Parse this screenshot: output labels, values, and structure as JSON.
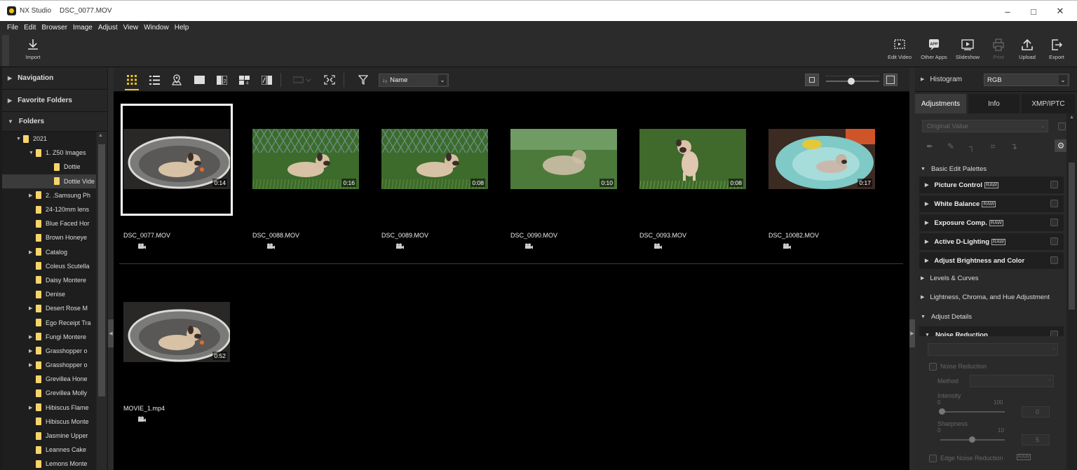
{
  "titlebar": {
    "app": "NX Studio",
    "file": "DSC_0077.MOV"
  },
  "menu": [
    "File",
    "Edit",
    "Browser",
    "Image",
    "Adjust",
    "View",
    "Window",
    "Help"
  ],
  "toolbar": {
    "import": "Import",
    "right": [
      {
        "label": "Edit Video",
        "icon": "edit-video-icon",
        "enabled": true
      },
      {
        "label": "Other Apps",
        "icon": "other-apps-icon",
        "enabled": true
      },
      {
        "label": "Slideshow",
        "icon": "slideshow-icon",
        "enabled": true
      },
      {
        "label": "Print",
        "icon": "print-icon",
        "enabled": false
      },
      {
        "label": "Upload",
        "icon": "upload-icon",
        "enabled": true
      },
      {
        "label": "Export",
        "icon": "export-icon",
        "enabled": true
      }
    ]
  },
  "left_panel": {
    "navigation": "Navigation",
    "favorites": "Favorite Folders",
    "folders": "Folders",
    "tree": [
      {
        "label": "2021",
        "level": 1,
        "state": "open"
      },
      {
        "label": "1. Z50 Images",
        "level": 2,
        "state": "open"
      },
      {
        "label": "Dottie",
        "level": 3,
        "state": "none"
      },
      {
        "label": "Dottie Vide",
        "level": 3,
        "state": "none",
        "selected": true
      },
      {
        "label": "2. .Samsung Ph",
        "level": 2,
        "state": "closed"
      },
      {
        "label": "24-120mm lens",
        "level": 2,
        "state": "none"
      },
      {
        "label": "Blue Faced Hor",
        "level": 2,
        "state": "none"
      },
      {
        "label": "Brown Honeye",
        "level": 2,
        "state": "none"
      },
      {
        "label": "Catalog",
        "level": 2,
        "state": "closed"
      },
      {
        "label": "Coleus Scutella",
        "level": 2,
        "state": "none"
      },
      {
        "label": "Daisy Montere",
        "level": 2,
        "state": "none"
      },
      {
        "label": "Denise",
        "level": 2,
        "state": "none"
      },
      {
        "label": "Desert Rose M",
        "level": 2,
        "state": "closed"
      },
      {
        "label": "Ego Receipt Tra",
        "level": 2,
        "state": "none"
      },
      {
        "label": "Fungi Montere",
        "level": 2,
        "state": "closed"
      },
      {
        "label": "Grasshopper o",
        "level": 2,
        "state": "closed"
      },
      {
        "label": "Grasshopper o",
        "level": 2,
        "state": "closed"
      },
      {
        "label": "Grevillea Hone",
        "level": 2,
        "state": "none"
      },
      {
        "label": "Grevillea Molly",
        "level": 2,
        "state": "none"
      },
      {
        "label": "Hibiscus Flame",
        "level": 2,
        "state": "closed"
      },
      {
        "label": "Hibiscus Monte",
        "level": 2,
        "state": "none"
      },
      {
        "label": "Jasmine Upper",
        "level": 2,
        "state": "none"
      },
      {
        "label": "Leannes Cake",
        "level": 2,
        "state": "none"
      },
      {
        "label": "Lemons Monte",
        "level": 2,
        "state": "none"
      }
    ]
  },
  "browser": {
    "sort_label": "Name",
    "thumbs": [
      {
        "name": "DSC_0077.MOV",
        "duration": "0:14",
        "scene": "bed",
        "selected": true
      },
      {
        "name": "DSC_0088.MOV",
        "duration": "0:16",
        "scene": "grass"
      },
      {
        "name": "DSC_0089.MOV",
        "duration": "0:08",
        "scene": "grass"
      },
      {
        "name": "DSC_0090.MOV",
        "duration": "0:10",
        "scene": "grass-blur"
      },
      {
        "name": "DSC_0093.MOV",
        "duration": "0:08",
        "scene": "grass-sit"
      },
      {
        "name": "DSC_10082.MOV",
        "duration": "0:17",
        "scene": "teal-bed"
      },
      {
        "name": "MOVIE_1.mp4",
        "duration": "0:52",
        "scene": "bed"
      }
    ]
  },
  "right_panel": {
    "histogram": "Histogram",
    "histogram_mode": "RGB",
    "tabs": [
      "Adjustments",
      "Info",
      "XMP/IPTC"
    ],
    "original_value": "Original Value",
    "basic_edit": "Basic Edit Palettes",
    "palettes": [
      {
        "label": "Picture Control",
        "raw": "RAW"
      },
      {
        "label": "White Balance",
        "raw": "RAW"
      },
      {
        "label": "Exposure Comp.",
        "raw": "RAW"
      },
      {
        "label": "Active D-Lighting",
        "raw": "RAW"
      },
      {
        "label": "Adjust Brightness and Color",
        "raw": ""
      }
    ],
    "levels": "Levels & Curves",
    "lch": "Lightness, Chroma, and Hue Adjustment",
    "adjust_details": "Adjust Details",
    "noise_reduction": "Noise Reduction",
    "nr_checkbox": "Noise Reduction",
    "method": "Method",
    "intensity": "Intensity",
    "intensity_min": "0",
    "intensity_max": "100",
    "intensity_value": "0",
    "sharpness": "Sharpness",
    "sharpness_min": "0",
    "sharpness_max": "10",
    "sharpness_value": "5",
    "edge_nr": "Edge Noise Reduction",
    "edge_raw": "RAW"
  }
}
